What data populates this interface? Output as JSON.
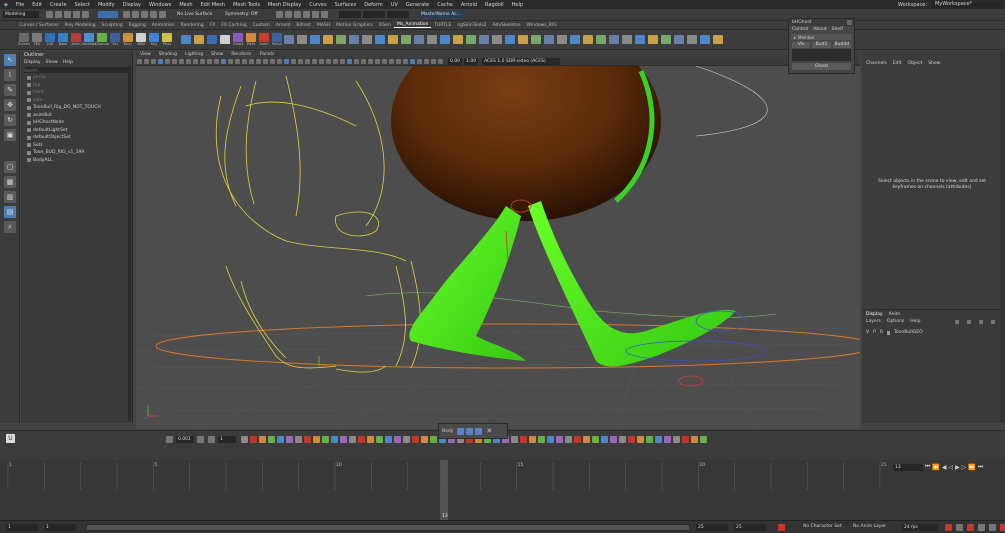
{
  "menu": [
    "File",
    "Edit",
    "Create",
    "Select",
    "Modify",
    "Display",
    "Windows",
    "Mesh",
    "Edit Mesh",
    "Mesh Tools",
    "Mesh Display",
    "Curves",
    "Surfaces",
    "Deform",
    "UV",
    "Generate",
    "Cache",
    "Arnold",
    "Ragdoll",
    "Help"
  ],
  "workspace": {
    "label": "Workspace:",
    "value": "MyWorkspace*"
  },
  "status": {
    "mode": "Modeling",
    "live_surface": "No Live Surface",
    "symmetry": "Symmetry: Off",
    "project": "MasterName Ac..."
  },
  "shelf_tabs": [
    "Curves / Surfaces",
    "Poly Modeling",
    "Sculpting",
    "Rigging",
    "Animation",
    "Rendering",
    "FX",
    "FX Caching",
    "Custom",
    "Arnold",
    "Bifrost",
    "MASH",
    "Motion Graphics",
    "XGen",
    "TURTLE",
    "ngSkinTools2",
    "AdvSkeleton",
    "Windows_RIG"
  ],
  "shelf_active": "Ms_Animation",
  "shelf_icons": [
    {
      "label": "Screen",
      "color": "#6a6a6a"
    },
    {
      "label": "FBX",
      "color": "#7a7a7a"
    },
    {
      "label": "2xD",
      "color": "#2f6fb8"
    },
    {
      "label": "Bake",
      "color": "#3a7fc4"
    },
    {
      "label": "Anim",
      "color": "#b04040"
    },
    {
      "label": "Settings",
      "color": "#4b8fd0"
    },
    {
      "label": "Cleanup",
      "color": "#6ab04a"
    },
    {
      "label": "Sel",
      "color": "#3d5f99"
    },
    {
      "label": "Keys",
      "color": "#c6923a"
    },
    {
      "label": "BEN",
      "color": "#d0d0d0"
    },
    {
      "label": "Key",
      "color": "#3f82d6"
    },
    {
      "label": "Phys",
      "color": "#d0c04a"
    },
    {
      "label": "",
      "color": "#4c88c9"
    },
    {
      "label": "",
      "color": "#c9a14a"
    },
    {
      "label": "",
      "color": "#3c6bb0"
    },
    {
      "label": "",
      "color": "#cfcfcf"
    },
    {
      "label": "Ghost",
      "color": "#8a5cb8"
    },
    {
      "label": "Pickr",
      "color": "#d08a3a"
    },
    {
      "label": "Anim",
      "color": "#cc3a2a"
    },
    {
      "label": "Polish",
      "color": "#3a63a0"
    }
  ],
  "outliner": {
    "title": "Outliner",
    "menu": [
      "Display",
      "Show",
      "Help"
    ],
    "search_placeholder": "Search...",
    "items": [
      "persp",
      "top",
      "front",
      "side",
      "ToonBull_Rig_DO_NOT_TOUCH",
      "animBot",
      "bHGhostNode",
      "defaultLightSet",
      "defaultObjectSet",
      "Sets",
      "Toon_BUD_RIG_v1_199",
      "BodyALL"
    ]
  },
  "viewport": {
    "menu": [
      "View",
      "Shading",
      "Lighting",
      "Show",
      "Renderer",
      "Panels"
    ],
    "fields": {
      "near": "0.00",
      "far": "1.00",
      "color_space": "ACES 1.0 SDR-video (ACES)"
    }
  },
  "popup": {
    "title": "bHGhost",
    "tabs": [
      "Control",
      "About",
      "Shelf"
    ],
    "section": "Member",
    "cols": [
      "Vis",
      "Bud1",
      "Bud4d"
    ],
    "button": "Ghost"
  },
  "channel_box": {
    "menu": [
      "Channels",
      "Edit",
      "Object",
      "Show"
    ],
    "message": "Select objects in the scene to view, edit and set keyframes on channels (attributes)",
    "layer_tabs": [
      "Display",
      "Anim"
    ],
    "layer_menu": [
      "Layers",
      "Options",
      "Help"
    ],
    "layer": {
      "v": "V",
      "p": "P",
      "r": "R",
      "name": "ToonBullGEO"
    }
  },
  "timebar": {
    "offset": "0.001",
    "rate": "1",
    "body_label": "Body"
  },
  "timeline": {
    "current": "13",
    "ticks": [
      "1",
      "5",
      "10",
      "15",
      "20",
      "25"
    ],
    "current_marker": "13"
  },
  "range": {
    "start": "1",
    "anim_start": "1",
    "anim_end": "25",
    "end": "25",
    "character_set": "No Character Set",
    "anim_layer": "No Anim Layer",
    "fps": "24 fps"
  }
}
